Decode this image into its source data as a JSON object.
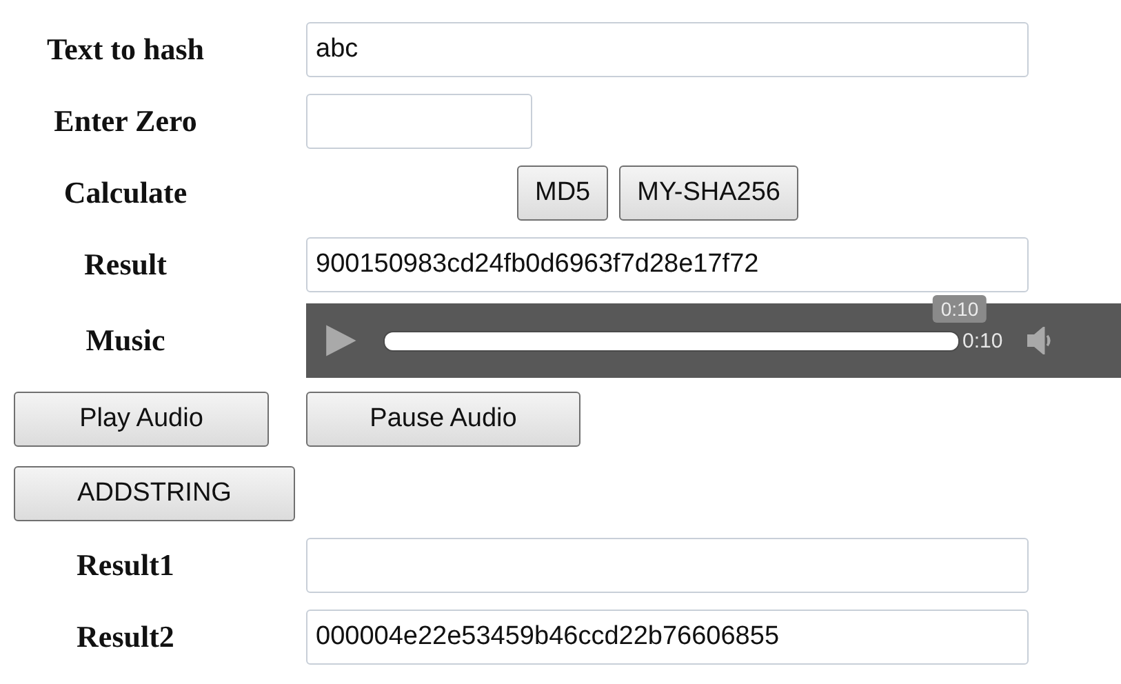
{
  "form": [
    {
      "kind": "input",
      "label": "Text to hash",
      "value": "abc",
      "wide": true
    },
    {
      "kind": "input",
      "label": "Enter Zero",
      "wide": false
    },
    {
      "kind": "buttons",
      "label": "Calculate",
      "buttons": [
        "MD5",
        "MY-SHA256"
      ]
    },
    {
      "kind": "input",
      "label": "Result",
      "value": "900150983cd24fb0d6963f7d28e17f72",
      "wide": true
    },
    {
      "kind": "audio",
      "label": "Music",
      "level": 1,
      "tooltip": "0:10",
      "time": "0:10"
    }
  ],
  "audio_buttons": [
    "Play Audio",
    "Pause Audio"
  ],
  "add_button": "ADDSTRING",
  "results": [
    {
      "label": "Result1"
    },
    {
      "label": "Result2",
      "value": "000004e22e53459b46ccd22b76606855"
    }
  ]
}
